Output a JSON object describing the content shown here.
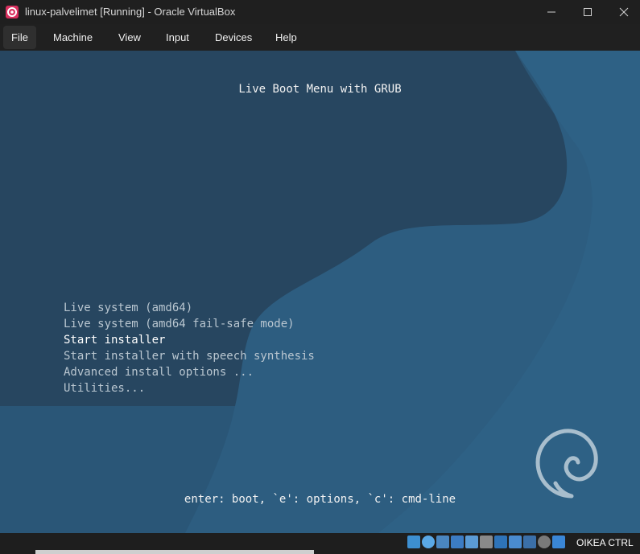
{
  "window": {
    "title": "linux-palvelimet [Running] - Oracle VirtualBox",
    "app_icon": "virtualbox-icon",
    "controls": [
      "minimize-icon",
      "maximize-icon",
      "close-icon"
    ]
  },
  "menubar": {
    "items": [
      {
        "label": "File",
        "active": true
      },
      {
        "label": "Machine"
      },
      {
        "label": "View"
      },
      {
        "label": "Input"
      },
      {
        "label": "Devices"
      },
      {
        "label": "Help"
      }
    ]
  },
  "vm": {
    "grub_title": "Live Boot Menu with GRUB",
    "menu_entries": [
      {
        "label": "Live system (amd64)",
        "selected": false
      },
      {
        "label": "Live system (amd64 fail-safe mode)",
        "selected": false
      },
      {
        "label": "Start installer",
        "selected": true
      },
      {
        "label": "Start installer with speech synthesis",
        "selected": false
      },
      {
        "label": "Advanced install options ...",
        "selected": false
      },
      {
        "label": "Utilities...",
        "selected": false
      }
    ],
    "help_line": "enter: boot, `e': options, `c': cmd-line",
    "logo": "debian-swirl-logo",
    "colors": {
      "background_dark": "#284a62",
      "background_light": "#2d5d80",
      "selected_text": "#ffffff",
      "entry_text": "#b9c6d0"
    }
  },
  "statusbar": {
    "icons": [
      "hard-disk-icon",
      "optical-drive-icon",
      "audio-icon",
      "network-icon",
      "usb-icon",
      "shared-folders-icon",
      "display-icon",
      "recording-icon",
      "virtualization-icon",
      "mouse-integration-icon",
      "keyboard-icon"
    ],
    "host_key": "OIKEA CTRL"
  }
}
